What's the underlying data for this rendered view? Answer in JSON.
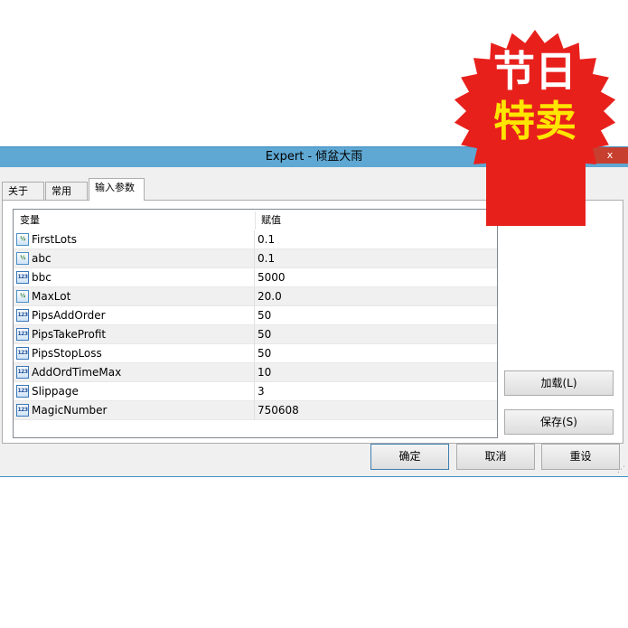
{
  "window": {
    "title": "Expert - 倾盆大雨",
    "close_label": "x"
  },
  "tabs": [
    {
      "label": "关于",
      "active": false
    },
    {
      "label": "常用",
      "active": false
    },
    {
      "label": "输入参数",
      "active": true
    }
  ],
  "grid": {
    "columns": [
      "变量",
      "赋值"
    ],
    "rows": [
      {
        "name": "FirstLots",
        "value": "0.1",
        "type_icon": "fraction-icon"
      },
      {
        "name": "abc",
        "value": "0.1",
        "type_icon": "fraction-icon"
      },
      {
        "name": "bbc",
        "value": "5000",
        "type_icon": "integer-icon"
      },
      {
        "name": "MaxLot",
        "value": "20.0",
        "type_icon": "fraction-icon"
      },
      {
        "name": "PipsAddOrder",
        "value": "50",
        "type_icon": "integer-icon"
      },
      {
        "name": "PipsTakeProfit",
        "value": "50",
        "type_icon": "integer-icon"
      },
      {
        "name": "PipsStopLoss",
        "value": "50",
        "type_icon": "integer-icon"
      },
      {
        "name": "AddOrdTimeMax",
        "value": "10",
        "type_icon": "integer-icon"
      },
      {
        "name": "Slippage",
        "value": "3",
        "type_icon": "integer-icon"
      },
      {
        "name": "MagicNumber",
        "value": "750608",
        "type_icon": "integer-icon"
      }
    ],
    "icon_text": {
      "fraction": "½",
      "integer": "123"
    }
  },
  "side_buttons": {
    "load": "加载(L)",
    "save": "保存(S)"
  },
  "footer_buttons": {
    "ok": "确定",
    "cancel": "取消",
    "reset": "重设"
  },
  "promo_badge": {
    "line1": "节日",
    "line2": "特卖",
    "color": "#e8201c",
    "text_color_1": "#ffffff",
    "text_color_2": "#ffe600"
  }
}
